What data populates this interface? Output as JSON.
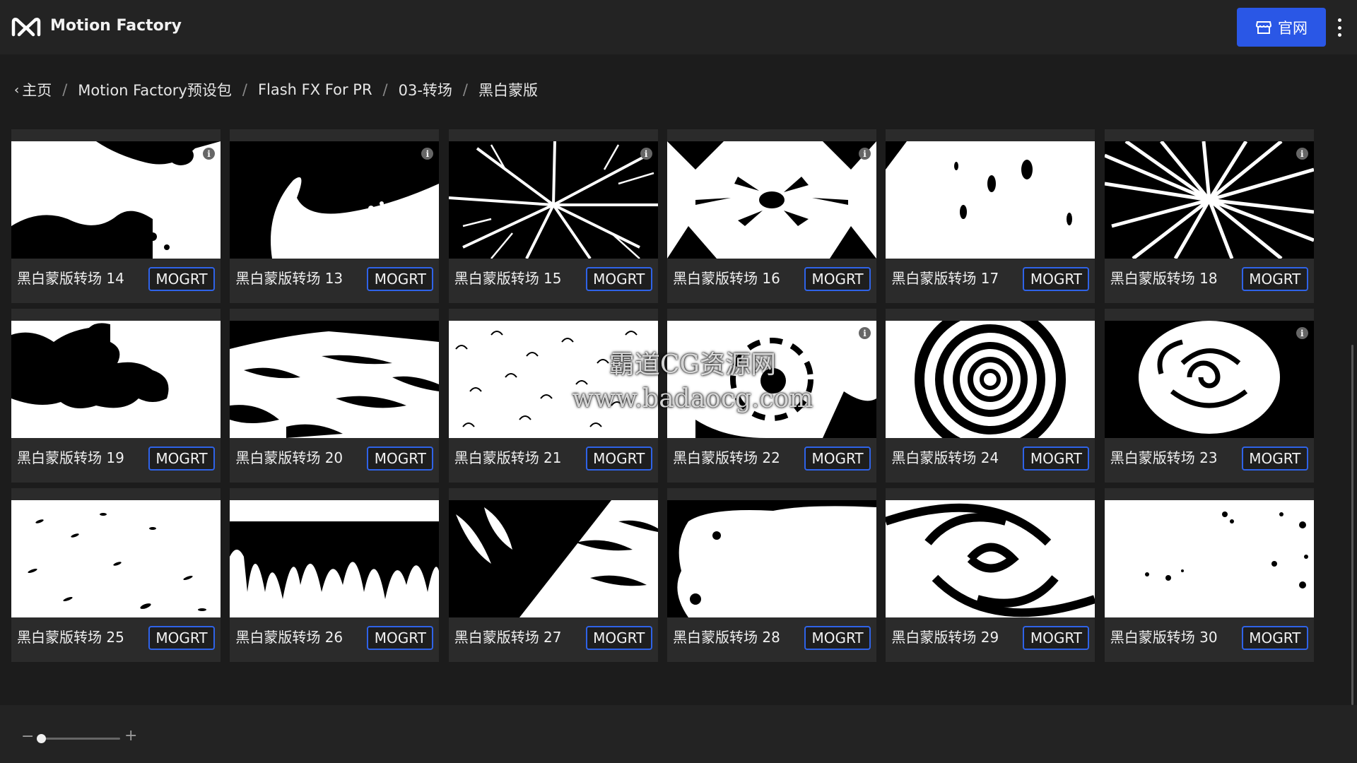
{
  "header": {
    "app_title": "Motion Factory",
    "official_label": "官网"
  },
  "breadcrumb": [
    "主页",
    "Motion Factory预设包",
    "Flash FX For PR",
    "03-转场",
    "黑白蒙版"
  ],
  "watermark": {
    "line1": "霸道CG资源网",
    "line2": "www.badaocg.com"
  },
  "badge_label": "MOGRT",
  "cards": [
    {
      "label": "黑白蒙版转场 14",
      "pattern": "splash",
      "info": true
    },
    {
      "label": "黑白蒙版转场 13",
      "pattern": "wave",
      "info": true
    },
    {
      "label": "黑白蒙版转场 15",
      "pattern": "branches",
      "info": true
    },
    {
      "label": "黑白蒙版转场 16",
      "pattern": "burst",
      "info": true
    },
    {
      "label": "黑白蒙版转场 17",
      "pattern": "drops",
      "info": false
    },
    {
      "label": "黑白蒙版转场 18",
      "pattern": "rays",
      "info": true
    },
    {
      "label": "黑白蒙版转场 19",
      "pattern": "smoke",
      "info": false
    },
    {
      "label": "黑白蒙版转场 20",
      "pattern": "streaks",
      "info": false
    },
    {
      "label": "黑白蒙版转场 21",
      "pattern": "bubbles",
      "info": false
    },
    {
      "label": "黑白蒙版转场 22",
      "pattern": "ring",
      "info": true
    },
    {
      "label": "黑白蒙版转场 24",
      "pattern": "spiral",
      "info": false
    },
    {
      "label": "黑白蒙版转场 23",
      "pattern": "swirl",
      "info": true
    },
    {
      "label": "黑白蒙版转场 25",
      "pattern": "dashes",
      "info": false
    },
    {
      "label": "黑白蒙版转场 26",
      "pattern": "drips",
      "info": false
    },
    {
      "label": "黑白蒙版转场 27",
      "pattern": "diagonal",
      "info": false
    },
    {
      "label": "黑白蒙版转场 28",
      "pattern": "blob",
      "info": false
    },
    {
      "label": "黑白蒙版转场 29",
      "pattern": "vortex",
      "info": false
    },
    {
      "label": "黑白蒙版转场 30",
      "pattern": "specks",
      "info": false
    }
  ],
  "colors": {
    "accent": "#2a57e6",
    "badge_border": "#2f63e8",
    "card_bg": "#2b2b2b",
    "page_bg": "#1c1c1c"
  },
  "zoom": {
    "level": 0.05
  }
}
